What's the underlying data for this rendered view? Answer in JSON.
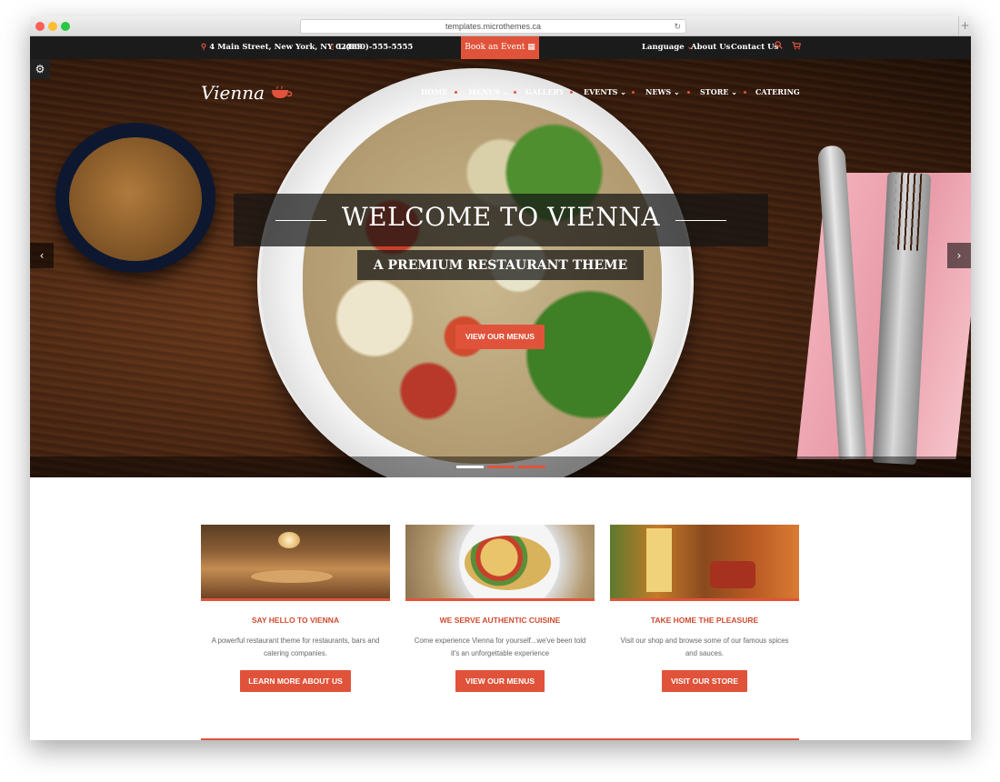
{
  "browser": {
    "url": "templates.microthemes.ca"
  },
  "topbar": {
    "address": "4 Main Street, New York, NY 02489",
    "phone": "1-(800)-555-5555",
    "book_button": "Book an Event",
    "language": "Language",
    "about": "About Us",
    "contact": "Contact Us"
  },
  "brand": {
    "logo_text": "Vienna"
  },
  "nav": {
    "items": [
      {
        "label": "HOME"
      },
      {
        "label": "MENUS"
      },
      {
        "label": "GALLERY"
      },
      {
        "label": "EVENTS"
      },
      {
        "label": "NEWS"
      },
      {
        "label": "STORE"
      },
      {
        "label": "CATERING"
      }
    ]
  },
  "hero": {
    "title": "WELCOME TO VIENNA",
    "subtitle": "A PREMIUM RESTAURANT THEME",
    "button": "VIEW OUR MENUS",
    "slide_count": 3,
    "active_slide": 1,
    "prev_glyph": "‹",
    "next_glyph": "›"
  },
  "features": [
    {
      "heading": "SAY HELLO TO VIENNA",
      "description": "A powerful restaurant theme for restaurants, bars and catering companies.",
      "button": "LEARN MORE ABOUT US"
    },
    {
      "heading": "WE SERVE AUTHENTIC CUISINE",
      "description": "Come experience Vienna for yourself...we've been told it's an unforgettable experience",
      "button": "VIEW OUR MENUS"
    },
    {
      "heading": "TAKE HOME THE PLEASURE",
      "description": "Visit our shop and browse some of our famous spices and sauces.",
      "button": "VISIT OUR STORE"
    }
  ],
  "colors": {
    "accent": "#e0533a",
    "topbar_bg": "#1b1b1b"
  },
  "icons": {
    "settings": "gear-icon",
    "location": "map-pin-icon",
    "phone": "phone-icon",
    "calendar": "calendar-icon",
    "search": "search-icon",
    "cart": "cart-icon",
    "logo": "coffee-cup-icon"
  }
}
